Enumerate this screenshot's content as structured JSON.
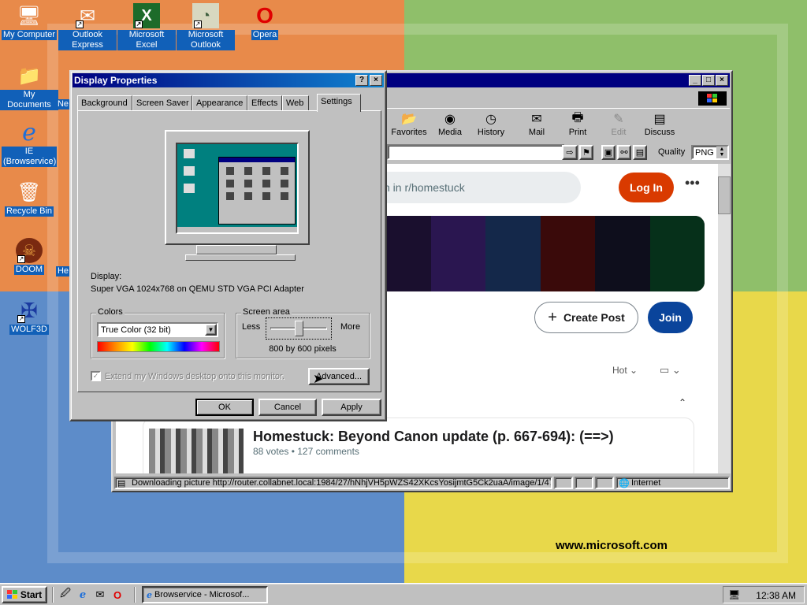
{
  "desktop": {
    "watermark": "www.microsoft.com",
    "icons": [
      {
        "label": "My Computer",
        "glyph": "🖥"
      },
      {
        "label": "My Documents",
        "glyph": "📁"
      },
      {
        "label": "IE (Browservice)",
        "glyph": "e"
      },
      {
        "label": "Recycle Bin",
        "glyph": "🗑"
      },
      {
        "label": "DOOM",
        "glyph": "☠"
      },
      {
        "label": "WOLF3D",
        "glyph": "✠"
      },
      {
        "label": "Outlook Express",
        "glyph": "✉"
      },
      {
        "label": "Microsoft Excel",
        "glyph": "X"
      },
      {
        "label": "Microsoft Outlook",
        "glyph": "◔"
      },
      {
        "label": "Opera",
        "glyph": "O"
      },
      {
        "label": "Ne",
        "glyph": ""
      },
      {
        "label": "He",
        "glyph": ""
      }
    ]
  },
  "browser": {
    "toolbar": [
      {
        "label": "Favorites",
        "icon": "favorites-icon",
        "glyph": "📂"
      },
      {
        "label": "Media",
        "icon": "media-icon",
        "glyph": "◉"
      },
      {
        "label": "History",
        "icon": "history-icon",
        "glyph": "◷"
      },
      {
        "label": "Mail",
        "icon": "mail-icon",
        "glyph": "✉"
      },
      {
        "label": "Print",
        "icon": "print-icon",
        "glyph": "🖶"
      },
      {
        "label": "Edit",
        "icon": "edit-icon",
        "glyph": "✎",
        "disabled": true
      },
      {
        "label": "Discuss",
        "icon": "discuss-icon",
        "glyph": "▤"
      }
    ],
    "quality_label": "Quality",
    "quality_value": "PNG",
    "status_text": "Downloading picture http://router.collabnet.local:1984/27/hNhjVH5pWZS42XKcsYosijmtG5Ck2uaA/image/1/478",
    "status_zone": "Internet",
    "page": {
      "search_placeholder": "n in r/homestuck",
      "login_label": "Log In",
      "more_label": "•••",
      "create_post_label": "Create Post",
      "join_label": "Join",
      "sort_label": "Hot",
      "post_title": "Homestuck: Beyond Canon update (p. 667-694): (==>)",
      "post_meta": "88 votes • 127 comments",
      "banner_colors": [
        "#1a0f2e",
        "#2a1650",
        "#14284a",
        "#3a0a0a",
        "#0e0e1c",
        "#06301a"
      ]
    }
  },
  "dialog": {
    "title": "Display Properties",
    "tabs": [
      "Background",
      "Screen Saver",
      "Appearance",
      "Effects",
      "Web",
      "Settings"
    ],
    "active_tab": "Settings",
    "display_label": "Display:",
    "display_value": "Super VGA 1024x768 on QEMU STD VGA PCI Adapter",
    "colors_legend": "Colors",
    "colors_value": "True Color (32 bit)",
    "screen_area_legend": "Screen area",
    "less_label": "Less",
    "more_label": "More",
    "resolution_text": "800 by 600 pixels",
    "slider_level": 0.5,
    "extend_label": "Extend my Windows desktop onto this monitor.",
    "advanced_label": "Advanced...",
    "ok_label": "OK",
    "cancel_label": "Cancel",
    "apply_label": "Apply"
  },
  "taskbar": {
    "start_label": "Start",
    "task_label": "Browservice - Microsof...",
    "clock": "12:38 AM"
  },
  "colors": {
    "title_active": "#000080",
    "reddit_orange": "#d93a00",
    "reddit_blue": "#0a449b",
    "win_face": "#c0c0c0"
  }
}
